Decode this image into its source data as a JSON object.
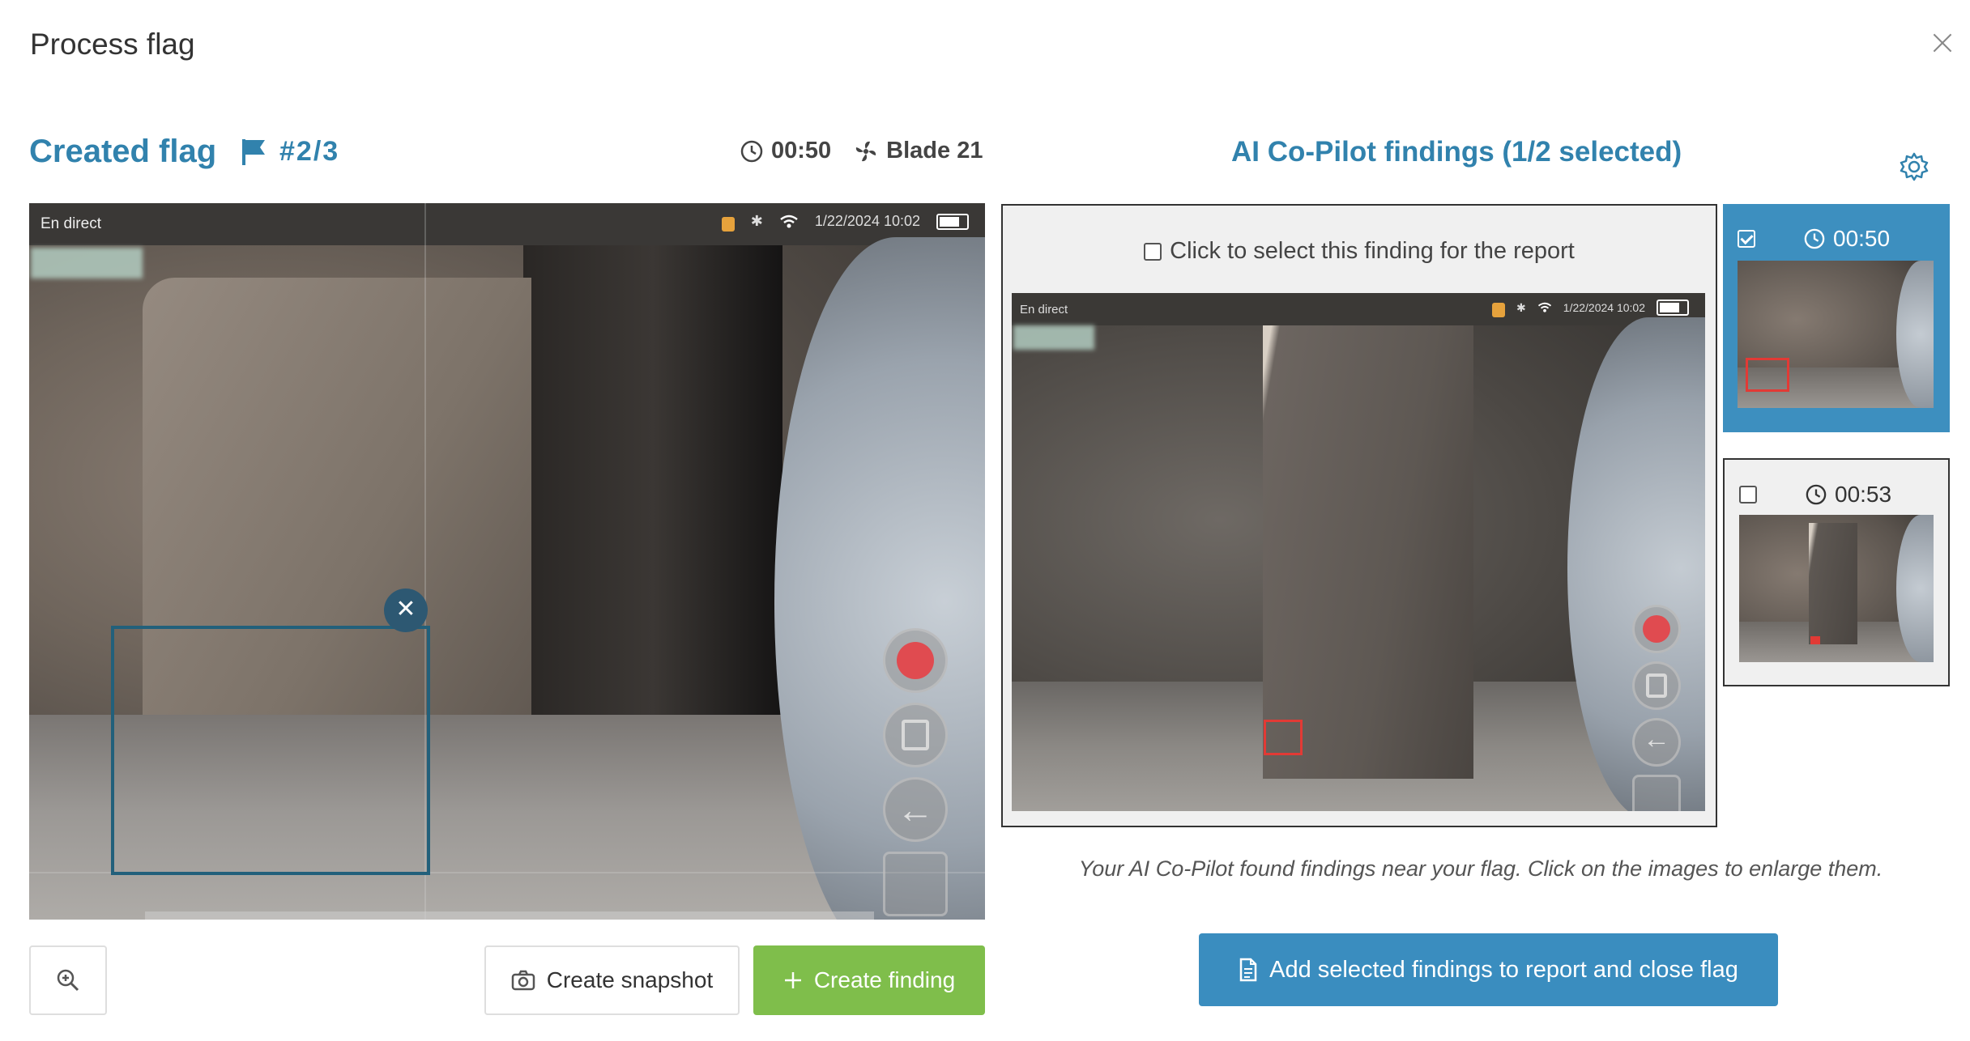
{
  "modal": {
    "title": "Process flag"
  },
  "flag": {
    "title": "Created flag",
    "count": "#2/3",
    "time": "00:50",
    "blade": "Blade 21"
  },
  "viewer": {
    "live_label": "En direct",
    "datetime": "1/22/2024  10:02"
  },
  "left_buttons": {
    "snapshot_label": "Create snapshot",
    "finding_label": "Create finding"
  },
  "ai": {
    "title": "AI Co-Pilot findings (1/2 selected)",
    "select_label": "Click to select this finding for the report",
    "caption": "Your AI Co-Pilot found findings near your flag. Click on the images to enlarge them.",
    "add_button_label": "Add selected findings to report and close flag",
    "finding_image": {
      "live_label": "En direct",
      "datetime": "1/22/2024  10:02"
    },
    "thumbnails": [
      {
        "time": "00:50",
        "selected": true
      },
      {
        "time": "00:53",
        "selected": false
      }
    ]
  },
  "colors": {
    "accent": "#3182ad",
    "primary_button": "#3a8dbf",
    "success_button": "#7fbe4b",
    "selection_box": "#22607b",
    "finding_box": "#e23a35"
  },
  "icons": [
    "close-icon",
    "flag-icon",
    "clock-icon",
    "fan-icon",
    "gear-icon",
    "zoom-in-icon",
    "camera-icon",
    "plus-icon",
    "document-icon",
    "checkbox-icon"
  ]
}
